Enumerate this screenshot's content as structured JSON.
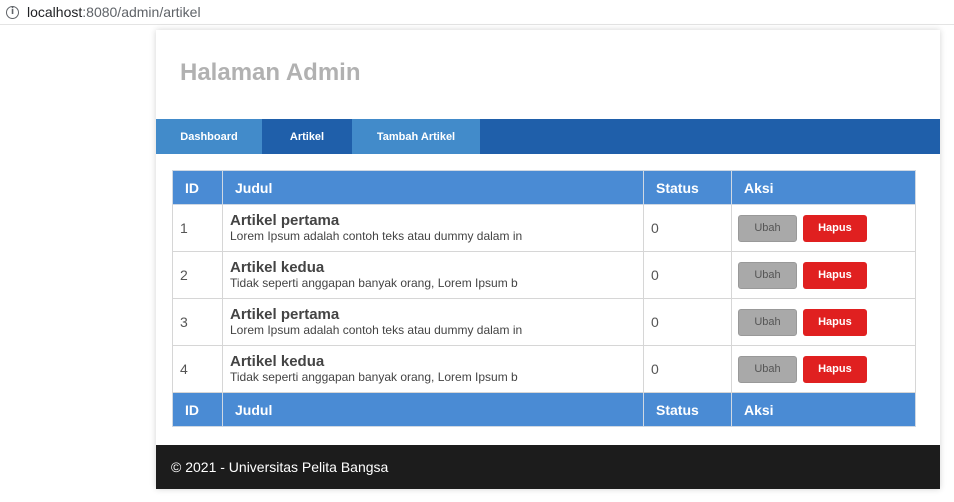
{
  "browser": {
    "info_icon": "info-icon",
    "url_host": "localhost",
    "url_path": ":8080/admin/artikel"
  },
  "header": {
    "title": "Halaman Admin"
  },
  "nav": {
    "dashboard": "Dashboard",
    "artikel": "Artikel",
    "tambah": "Tambah Artikel"
  },
  "table": {
    "headers": {
      "id": "ID",
      "judul": "Judul",
      "status": "Status",
      "aksi": "Aksi"
    },
    "rows": [
      {
        "id": "1",
        "title": "Artikel pertama",
        "desc": "Lorem Ipsum adalah contoh teks atau dummy dalam in",
        "status": "0",
        "ubah": "Ubah",
        "hapus": "Hapus"
      },
      {
        "id": "2",
        "title": "Artikel kedua",
        "desc": "Tidak seperti anggapan banyak orang, Lorem Ipsum b",
        "status": "0",
        "ubah": "Ubah",
        "hapus": "Hapus"
      },
      {
        "id": "3",
        "title": "Artikel pertama",
        "desc": "Lorem Ipsum adalah contoh teks atau dummy dalam in",
        "status": "0",
        "ubah": "Ubah",
        "hapus": "Hapus"
      },
      {
        "id": "4",
        "title": "Artikel kedua",
        "desc": "Tidak seperti anggapan banyak orang, Lorem Ipsum b",
        "status": "0",
        "ubah": "Ubah",
        "hapus": "Hapus"
      }
    ],
    "footers": {
      "id": "ID",
      "judul": "Judul",
      "status": "Status",
      "aksi": "Aksi"
    }
  },
  "footer": {
    "text": "© 2021 - Universitas Pelita Bangsa"
  },
  "colors": {
    "nav_bg": "#1f5faa",
    "nav_active": "#428bca",
    "table_header": "#4a8bd4",
    "ubah_button": "#a9a9a9",
    "hapus_button": "#e02020",
    "footer_bg": "#1c1c1c"
  }
}
